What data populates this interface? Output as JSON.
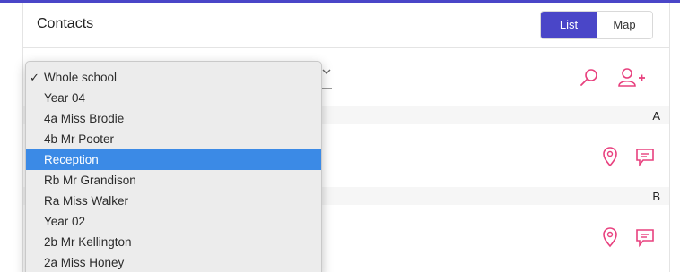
{
  "header": {
    "title": "Contacts",
    "view_toggle": [
      {
        "label": "List",
        "active": true
      },
      {
        "label": "Map",
        "active": false
      }
    ]
  },
  "toolbar": {
    "icons": [
      "search-icon",
      "add-person-icon"
    ]
  },
  "sections": [
    {
      "letter": "A",
      "row_icons": [
        "map-pin-icon",
        "message-icon"
      ]
    },
    {
      "letter": "B",
      "row_icons": [
        "map-pin-icon",
        "message-icon"
      ]
    }
  ],
  "dropdown": {
    "checkmark": "✓",
    "options": [
      {
        "label": "Whole school",
        "checked": true,
        "highlighted": false
      },
      {
        "label": "Year 04",
        "checked": false,
        "highlighted": false
      },
      {
        "label": "4a Miss Brodie",
        "checked": false,
        "highlighted": false
      },
      {
        "label": "4b Mr Pooter",
        "checked": false,
        "highlighted": false
      },
      {
        "label": "Reception",
        "checked": false,
        "highlighted": true
      },
      {
        "label": "Rb Mr Grandison",
        "checked": false,
        "highlighted": false
      },
      {
        "label": "Ra Miss Walker",
        "checked": false,
        "highlighted": false
      },
      {
        "label": "Year 02",
        "checked": false,
        "highlighted": false
      },
      {
        "label": "2b Mr Kellington",
        "checked": false,
        "highlighted": false
      },
      {
        "label": "2a Miss Honey",
        "checked": false,
        "highlighted": false
      }
    ]
  },
  "colors": {
    "accent": "#4a46c8",
    "icon_pink": "#e8407e",
    "highlight_blue": "#3b8ae6"
  }
}
